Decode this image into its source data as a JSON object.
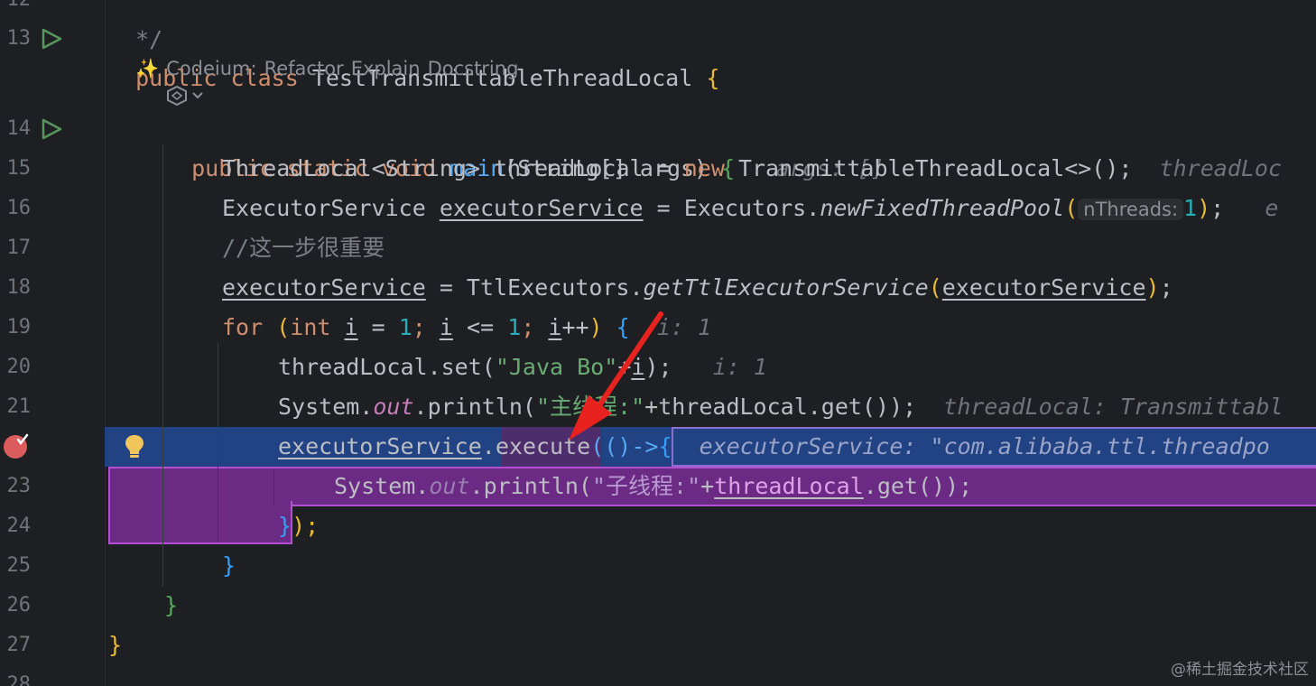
{
  "gutter": {
    "line_numbers": [
      "12",
      "13",
      "14",
      "15",
      "16",
      "17",
      "18",
      "19",
      "20",
      "21",
      "23",
      "24",
      "25",
      "26",
      "27",
      "28"
    ]
  },
  "codeium": {
    "label": "Codeium:",
    "refactor": "Refactor",
    "explain": "Explain",
    "docstring": "Docstring",
    "sparkle": "✨"
  },
  "code": {
    "l12": "*/",
    "l13_kw1": "public",
    "l13_kw2": "class",
    "l13_name": "TestTransmittableThreadLocal",
    "l14_kw": "public static void",
    "l14_fn": "main",
    "l14_params": "(String[] args)",
    "l14_hint": "args: []",
    "l15_type": "ThreadLocal<String> threadLocal = ",
    "l15_new": "new",
    "l15_rest": " TransmittableThreadLocal<>();",
    "l15_hint": "threadLoc",
    "l16_type": "ExecutorService ",
    "l16_var": "executorService",
    "l16_eq": " = Executors.",
    "l16_call": "newFixedThreadPool",
    "l16_inlay": "nThreads:",
    "l16_arg": "1",
    "l16_end": ");",
    "l16_hint": "e",
    "l17_comment": "//这一步很重要",
    "l18_var": "executorService",
    "l18_eq": " = TtlExecutors.",
    "l18_call": "getTtlExecutorService",
    "l18_arg": "executorService",
    "l18_end": ");",
    "l19_for": "for",
    "l19_int": "int",
    "l19_i": "i",
    "l19_n1": "1",
    "l19_n2": "1",
    "l19_hint": "i: 1",
    "l20_a": "threadLocal.set(",
    "l20_str": "\"Java Bo",
    "l20_b": "\"+",
    "l20_i": "i",
    "l20_c": ");",
    "l20_hint": "i: 1",
    "l21_a": "System.",
    "l21_out": "out",
    "l21_b": ".println(",
    "l21_str": "\"主线程:\"",
    "l21_c": "+threadLocal.get());",
    "l21_hint": "threadLocal: Transmittabl",
    "l22_var": "executorService",
    "l22_dot": ".",
    "l22_call": "execute",
    "l22_lambda": "(()->",
    "l22_brace": "{",
    "l22_hint": "executorService: \"com.alibaba.ttl.threadpo",
    "l23_a": "System.",
    "l23_out": "out",
    "l23_b": ".println(",
    "l23_str": "\"子线程:\"",
    "l23_plus": "+",
    "l23_var": "threadLocal",
    "l23_c": ".get());",
    "l24_brace": "}",
    "l24_end": ");",
    "l25": "}",
    "l26": "}",
    "l27": "}"
  },
  "watermark": "@稀土掘金技术社区"
}
